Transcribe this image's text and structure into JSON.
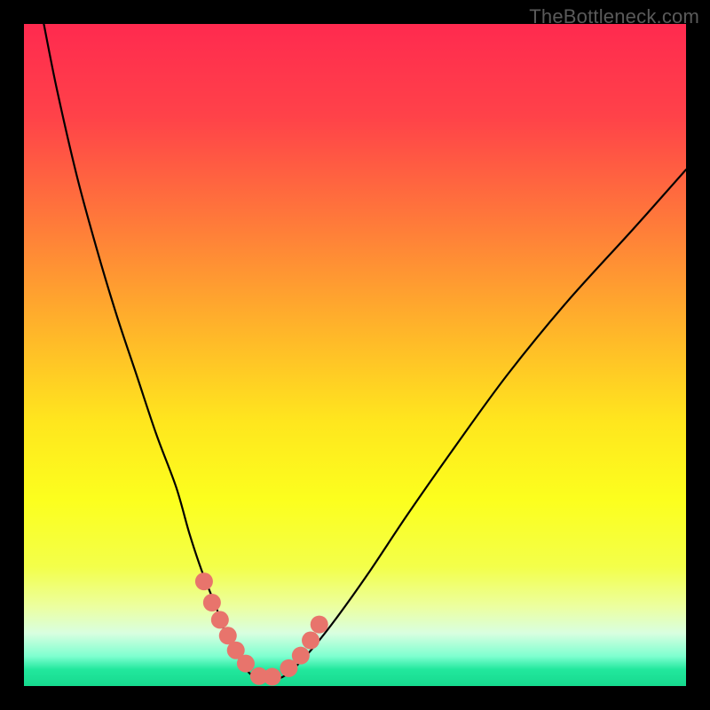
{
  "watermark": "TheBottleneck.com",
  "colors": {
    "page_bg": "#000000",
    "curve": "#000000",
    "marker_fill": "#e8746c",
    "marker_stroke": "#e8746c",
    "gradient_stops": [
      {
        "offset": 0.0,
        "color": "#ff2a4f"
      },
      {
        "offset": 0.14,
        "color": "#ff4249"
      },
      {
        "offset": 0.3,
        "color": "#ff7a3a"
      },
      {
        "offset": 0.46,
        "color": "#ffb42a"
      },
      {
        "offset": 0.6,
        "color": "#ffe61e"
      },
      {
        "offset": 0.72,
        "color": "#fcff1e"
      },
      {
        "offset": 0.82,
        "color": "#f3ff4a"
      },
      {
        "offset": 0.88,
        "color": "#ecffa0"
      },
      {
        "offset": 0.92,
        "color": "#d9ffe0"
      },
      {
        "offset": 0.955,
        "color": "#7effd0"
      },
      {
        "offset": 0.975,
        "color": "#22e89d"
      },
      {
        "offset": 1.0,
        "color": "#16d98e"
      }
    ]
  },
  "plot": {
    "viewbox_w": 746,
    "viewbox_h": 746
  },
  "chart_data": {
    "type": "line",
    "title": "",
    "xlabel": "",
    "ylabel": "",
    "xlim": [
      0,
      100
    ],
    "ylim": [
      0,
      100
    ],
    "grid": false,
    "note": "Axes are implicit (no visible ticks). Values are estimated from pixel positions on a 0–100 normalized scale for both axes. The curve represents a bottleneck/mismatch metric reaching ~0 near x≈35 and rising toward both ends.",
    "series": [
      {
        "name": "curve",
        "x": [
          3,
          5,
          8,
          11,
          14,
          17,
          20,
          23,
          25,
          27,
          29,
          30,
          32,
          34,
          36,
          38,
          40,
          43,
          47,
          52,
          58,
          65,
          73,
          82,
          92,
          100
        ],
        "y": [
          100,
          90,
          77,
          66,
          56,
          47,
          38,
          30,
          23,
          17,
          12,
          9,
          5,
          2,
          1,
          1,
          2,
          5,
          10,
          17,
          26,
          36,
          47,
          58,
          69,
          78
        ]
      }
    ],
    "markers": {
      "name": "highlighted-points",
      "x": [
        27.2,
        28.4,
        29.6,
        30.8,
        32.0,
        33.5,
        35.5,
        37.5,
        40.0,
        41.8,
        43.3,
        44.6
      ],
      "y": [
        15.8,
        12.6,
        10.0,
        7.6,
        5.4,
        3.4,
        1.5,
        1.4,
        2.7,
        4.6,
        6.9,
        9.3
      ]
    }
  }
}
